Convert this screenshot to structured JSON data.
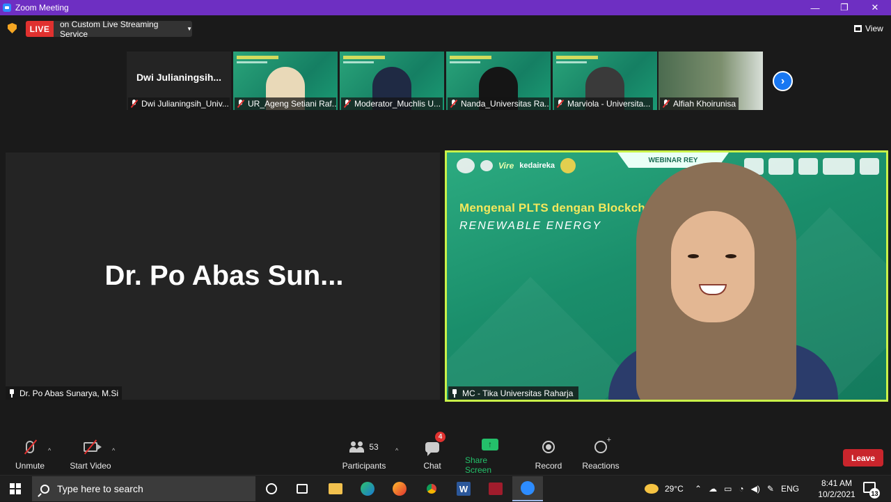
{
  "window": {
    "title": "Zoom Meeting",
    "minimize_icon": "minimize-icon",
    "restore_icon": "restore-icon",
    "close_icon": "close-icon"
  },
  "topbar": {
    "live_label": "LIVE",
    "live_service": "on Custom Live Streaming Service",
    "view_label": "View"
  },
  "participants_strip": [
    {
      "label": "Dwi Julianingsih_Univ...",
      "big_name": "Dwi  Julianingsih...",
      "video": false
    },
    {
      "label": "UR_Ageng Setiani Raf...",
      "video": true,
      "person_color": "#e9d9b8"
    },
    {
      "label": "Moderator_Muchlis U...",
      "video": true,
      "person_color": "#1f2a44"
    },
    {
      "label": "Nanda_Universitas Ra...",
      "video": true,
      "person_color": "#151515"
    },
    {
      "label": "Marviola - Universita...",
      "video": true,
      "person_color": "#3a3a3a"
    },
    {
      "label": "Alfiah Khoirunisa",
      "video": true,
      "person_color": "#c79a55"
    }
  ],
  "main": {
    "speaker_display_name": "Dr. Po Abas Sun...",
    "speaker_label": "Dr. Po Abas Sunarya, M.Si",
    "active_label": "MC - Tika Universitas Raharja",
    "slide": {
      "tag": "WEBINAR REY",
      "logo_text": "kedaireka",
      "logo_text2": "Vire",
      "title": "Mengenal PLTS dengan Blockchain",
      "subtitle": "RENEWABLE ENERGY"
    }
  },
  "toolbar": {
    "unmute": "Unmute",
    "start_video": "Start Video",
    "participants": "Participants",
    "participants_count": "53",
    "chat": "Chat",
    "chat_badge": "4",
    "share_screen": "Share Screen",
    "record": "Record",
    "reactions": "Reactions",
    "leave": "Leave"
  },
  "taskbar": {
    "search_placeholder": "Type here to search",
    "temperature": "29°C",
    "language": "ENG",
    "time": "8:41 AM",
    "date": "10/2/2021",
    "notification_count": "13"
  },
  "colors": {
    "titlebar": "#6e2fc2",
    "live": "#e0312f",
    "active_border": "#c9f249",
    "share_green": "#24c06a",
    "leave_red": "#c9252c"
  }
}
